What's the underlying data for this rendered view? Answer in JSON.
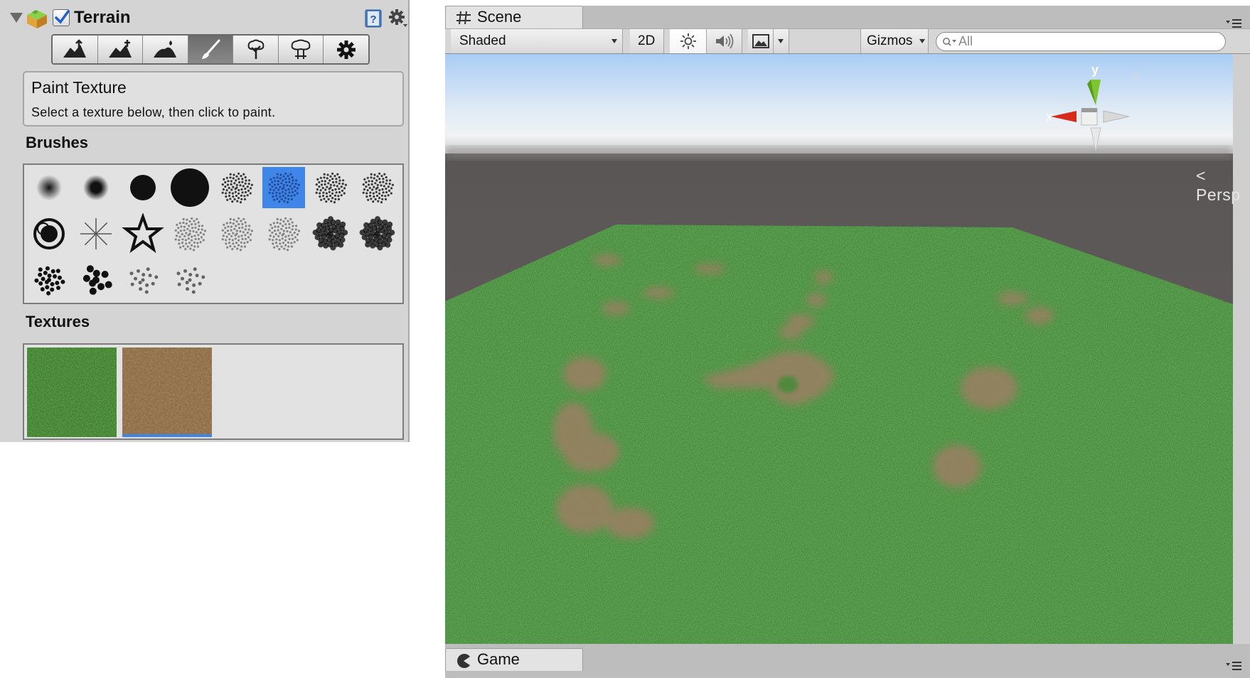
{
  "inspector": {
    "component_title": "Terrain",
    "enabled": true,
    "tools": [
      {
        "name": "raise-lower-terrain",
        "icon": "raise-terrain-icon"
      },
      {
        "name": "paint-height",
        "icon": "paint-height-icon"
      },
      {
        "name": "smooth-height",
        "icon": "smooth-height-icon"
      },
      {
        "name": "paint-texture",
        "icon": "paint-brush-icon",
        "active": true
      },
      {
        "name": "place-trees",
        "icon": "tree-icon"
      },
      {
        "name": "paint-details",
        "icon": "details-icon"
      },
      {
        "name": "terrain-settings",
        "icon": "gear-icon"
      }
    ],
    "tool_info": {
      "title": "Paint Texture",
      "description": "Select a texture below, then click to paint."
    },
    "brushes_label": "Brushes",
    "selected_brush": 5,
    "textures_label": "Textures",
    "textures": [
      {
        "name": "grass-texture",
        "color": "#3f7b2a"
      },
      {
        "name": "dirt-texture",
        "color": "#8a6a44",
        "selected": true
      }
    ]
  },
  "scene": {
    "tab_label": "Scene",
    "shading_mode": "Shaded",
    "mode_2d": "2D",
    "gizmos_label": "Gizmos",
    "search_placeholder": "All",
    "gizmo_axes": {
      "x": "x",
      "y": "y"
    },
    "projection_label": "Persp"
  },
  "game": {
    "tab_label": "Game"
  },
  "colors": {
    "selection_blue": "#3f86e8",
    "grass": "#4a8a3a",
    "ground": "#5e5a5a",
    "sky_top": "#a9cdf5"
  }
}
